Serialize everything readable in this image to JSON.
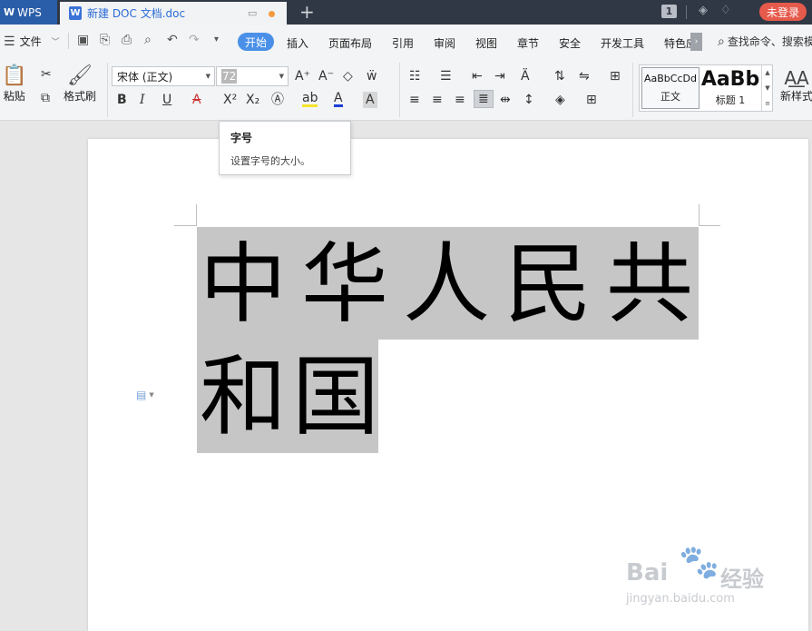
{
  "titlebar": {
    "app_tab": "WPS",
    "doc_tab": "新建 DOC 文档.doc",
    "badge": "1",
    "login_button": "未登录"
  },
  "menu": {
    "file_label": "文件",
    "active_tab": "开始",
    "tabs": [
      "插入",
      "页面布局",
      "引用",
      "审阅",
      "视图",
      "章节",
      "安全",
      "开发工具",
      "特色应"
    ],
    "search_label": "查找命令、搜索模"
  },
  "ribbon": {
    "paste_label": "粘贴",
    "format_painter_label": "格式刷",
    "font_name": "宋体 (正文)",
    "font_size": "72",
    "styles": [
      {
        "preview": "AaBbCcDd",
        "name": "正文"
      },
      {
        "preview": "AaBb",
        "name": "标题 1"
      }
    ],
    "new_style_label": "新样式"
  },
  "tooltip": {
    "title": "字号",
    "description": "设置字号的大小。"
  },
  "document": {
    "line1": "中华人民共",
    "line2": "和国"
  },
  "watermark": {
    "brand": "Bai",
    "brand_cn": "经验",
    "url": "jingyan.baidu.com"
  },
  "colors": {
    "titlebar_bg": "#313845",
    "active_tab_bg": "#4a90e8",
    "login_bg": "#e65a4c",
    "selection_bg": "#c6c6c6"
  }
}
